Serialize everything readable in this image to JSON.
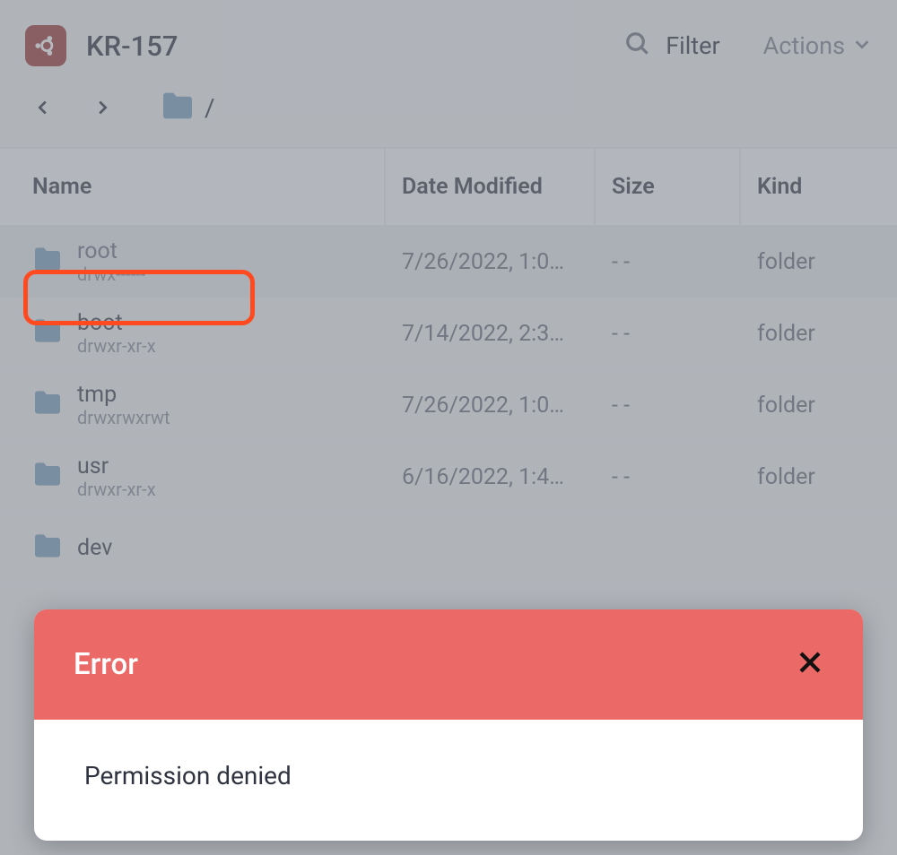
{
  "header": {
    "host": "KR-157",
    "filter_label": "Filter",
    "actions_label": "Actions"
  },
  "breadcrumb": {
    "path": "/"
  },
  "columns": {
    "name": "Name",
    "date": "Date Modified",
    "size": "Size",
    "kind": "Kind"
  },
  "rows": [
    {
      "name": "root",
      "perm": "drwx------",
      "date": "7/26/2022, 1:0…",
      "size": "- -",
      "kind": "folder",
      "selected": true
    },
    {
      "name": "boot",
      "perm": "drwxr-xr-x",
      "date": "7/14/2022, 2:3…",
      "size": "- -",
      "kind": "folder",
      "selected": false
    },
    {
      "name": "tmp",
      "perm": "drwxrwxrwt",
      "date": "7/26/2022, 1:0…",
      "size": "- -",
      "kind": "folder",
      "selected": false
    },
    {
      "name": "usr",
      "perm": "drwxr-xr-x",
      "date": "6/16/2022, 1:4…",
      "size": "- -",
      "kind": "folder",
      "selected": false
    },
    {
      "name": "dev",
      "perm": "",
      "date": "",
      "size": "",
      "kind": "",
      "selected": false
    }
  ],
  "modal": {
    "title": "Error",
    "message": "Permission denied"
  }
}
